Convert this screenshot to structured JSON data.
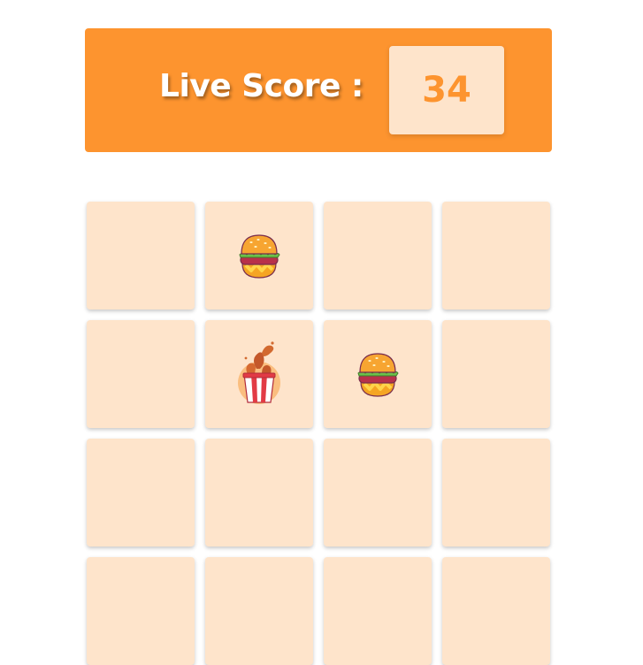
{
  "score": {
    "label": "Live Score :",
    "value": "34"
  },
  "colors": {
    "banner": "#fd942f",
    "card": "#fee4cb",
    "score_text": "#fd942f"
  },
  "cards": [
    {
      "state": "hidden",
      "icon": ""
    },
    {
      "state": "revealed",
      "icon": "burger-icon"
    },
    {
      "state": "hidden",
      "icon": ""
    },
    {
      "state": "hidden",
      "icon": ""
    },
    {
      "state": "hidden",
      "icon": ""
    },
    {
      "state": "revealed",
      "icon": "fried-chicken-bucket-icon"
    },
    {
      "state": "revealed",
      "icon": "burger-icon"
    },
    {
      "state": "hidden",
      "icon": ""
    },
    {
      "state": "hidden",
      "icon": ""
    },
    {
      "state": "hidden",
      "icon": ""
    },
    {
      "state": "hidden",
      "icon": ""
    },
    {
      "state": "hidden",
      "icon": ""
    },
    {
      "state": "hidden",
      "icon": ""
    },
    {
      "state": "hidden",
      "icon": ""
    },
    {
      "state": "hidden",
      "icon": ""
    },
    {
      "state": "hidden",
      "icon": ""
    }
  ]
}
